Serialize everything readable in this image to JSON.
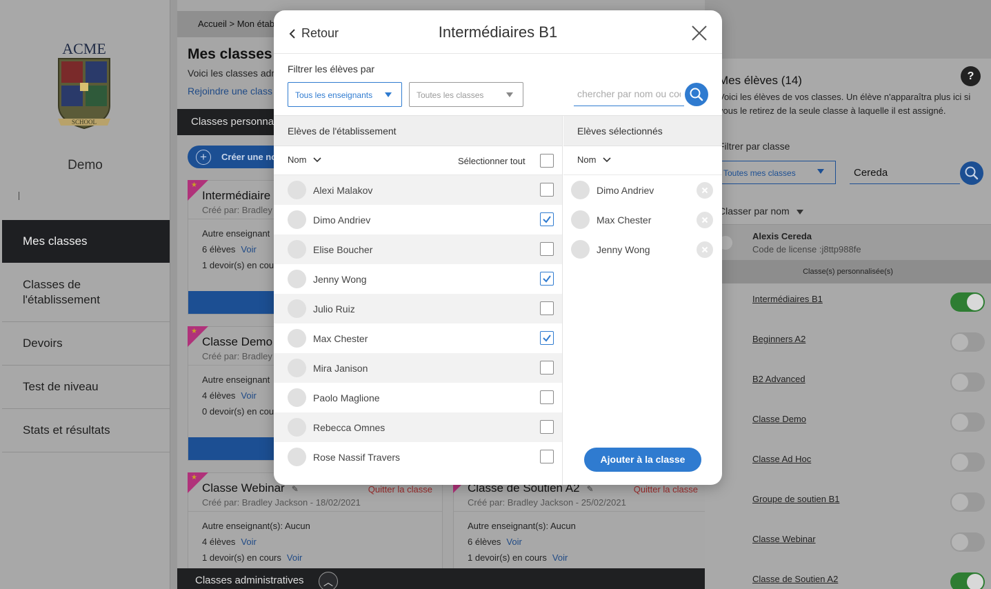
{
  "sidebar": {
    "logo_text": "ACME",
    "logo_sub": "SCHOOL",
    "user_name": "Demo",
    "items": [
      {
        "label": "Mes classes"
      },
      {
        "label": "Classes de l'établissement"
      },
      {
        "label": "Devoirs"
      },
      {
        "label": "Test de niveau"
      },
      {
        "label": "Stats et résultats"
      }
    ]
  },
  "main": {
    "breadcrumb": "Accueil > Mon étab",
    "title": "Mes classes",
    "subtitle": "Voici les classes adm",
    "join_link": "Rejoindre une class",
    "section_title": "Classes personna",
    "create_label": "Créer une no",
    "admin_section": "Classes administratives",
    "cards": [
      {
        "title": "Intermédiaire",
        "by": "Créé par: Bradley J",
        "line1": "Autre enseignant",
        "eleves": "6 élèves",
        "voir": "Voir",
        "devoirs": "1 devoir(s) en cou"
      },
      {
        "title": "Classe Demo",
        "by": "Créé par: Bradley J",
        "line1": "Autre enseignant",
        "eleves": "4 élèves",
        "voir": "Voir",
        "devoirs": "0 devoir(s) en cou"
      },
      {
        "title": "Classe Webinar",
        "by": "Créé par: Bradley Jackson - 18/02/2021",
        "quit": "Quitter la classe",
        "line1": "Autre enseignant(s): Aucun",
        "eleves": "4 élèves",
        "voir": "Voir",
        "devoirs": "1 devoir(s) en cours",
        "voir2": "Voir"
      },
      {
        "title": "Classe de Soutien A2",
        "by": "Créé par: Bradley Jackson - 25/02/2021",
        "quit": "Quitter la classe",
        "line1": "Autre enseignant(s): Aucun",
        "eleves": "6 élèves",
        "voir": "Voir",
        "devoirs": "1 devoir(s) en cours",
        "voir2": "Voir"
      }
    ]
  },
  "right_panel": {
    "title": "Mes élèves (14)",
    "help": "?",
    "description": "Voici les élèves de vos classes. Un élève n'apparaîtra plus ici si vous le retirez de la seule classe à laquelle il est assigné.",
    "filter_label": "Filtrer par classe",
    "filter_value": "Toutes mes classes",
    "search_value": "Cereda",
    "sort_label": "Classer par nom",
    "student_name": "Alexis Cereda",
    "student_code": "Code de license :j8ttp988fe",
    "classes_header": "Classe(s) personnalisée(s)",
    "classes": [
      {
        "name": "Intermédiaires B1",
        "on": true
      },
      {
        "name": "Beginners A2",
        "on": false
      },
      {
        "name": "B2 Advanced",
        "on": false
      },
      {
        "name": "Classe Demo",
        "on": false
      },
      {
        "name": "Classe Ad Hoc",
        "on": false
      },
      {
        "name": "Groupe de soutien B1",
        "on": false
      },
      {
        "name": "Classe Webinar",
        "on": false
      },
      {
        "name": "Classe de Soutien A2",
        "on": true
      }
    ]
  },
  "modal": {
    "back_label": "Retour",
    "title": "Intermédiaires B1",
    "filter_label": "Filtrer les élèves par",
    "teacher_select": "Tous les enseignants",
    "class_select": "Toutes les classes",
    "search_placeholder": "chercher par nom ou code",
    "left_header": "Elèves de l'établissement",
    "right_header": "Elèves sélectionnés",
    "sort_label": "Nom",
    "select_all": "Sélectionner tout",
    "students": [
      {
        "name": "Alexi Malakov",
        "checked": false
      },
      {
        "name": "Dimo Andriev",
        "checked": true
      },
      {
        "name": "Elise Boucher",
        "checked": false
      },
      {
        "name": "Jenny Wong",
        "checked": true
      },
      {
        "name": "Julio Ruiz",
        "checked": false
      },
      {
        "name": "Max Chester",
        "checked": true
      },
      {
        "name": "Mira Janison",
        "checked": false
      },
      {
        "name": "Paolo Maglione",
        "checked": false
      },
      {
        "name": "Rebecca Omnes",
        "checked": false
      },
      {
        "name": "Rose Nassif Travers",
        "checked": false
      }
    ],
    "selected": [
      {
        "name": "Dimo Andriev"
      },
      {
        "name": "Max Chester"
      },
      {
        "name": "Jenny Wong"
      }
    ],
    "add_button": "Ajouter à la classe"
  },
  "colors": {
    "accent": "#2f7bd0",
    "dark_accent": "#1c4f93",
    "toggle_on": "#2e7d32",
    "ribbon": "#b0327a",
    "quit": "#9b2b2b"
  }
}
